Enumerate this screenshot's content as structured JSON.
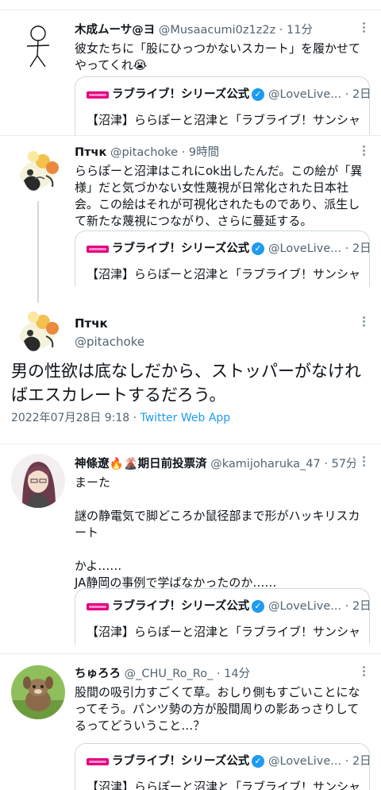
{
  "tweets": [
    {
      "name": "木成ムーサ@ヨ",
      "handle": "@Musaacumi0z1z2z",
      "time": "· 11分",
      "text": "彼女たちに「股にひっつかないスカート」を履かせてやってくれ😭",
      "avatar": "stick-figure",
      "quote": {
        "name": "ラブライブ！シリーズ公式",
        "handle": "@LoveLive... · 2日",
        "text": "【沼津】ららぽーと沼津と「ラブライブ！サンシャ"
      }
    },
    {
      "name": "Птчк",
      "handle": "@pitachoke",
      "time": "· 9時間",
      "text": "ららぽーと沼津はこれにok出したんだ。この絵が「異様」だと気づかない女性蔑視が日常化された日本社会。この絵はそれが可視化されたものであり、派生して新たな蔑視につながり、さらに蔓延する。",
      "avatar": "flower-art",
      "quote": {
        "name": "ラブライブ！シリーズ公式",
        "handle": "@LoveLive... · 2日",
        "text": "【沼津】ららぽーと沼津と「ラブライブ！サンシャ"
      }
    }
  ],
  "focus": {
    "name": "Птчк",
    "handle": "@pitachoke",
    "text": "男の性欲は底なしだから、ストッパーがなければエスカレートするだろう。",
    "date": "2022年07月28日 9:18 · ",
    "app": "Twitter Web App"
  },
  "replies": [
    {
      "name": "神條遼🔥🌋期日前投票済",
      "handle": "@kamijoharuka_47",
      "time": "· 57分",
      "lines": [
        "まーた",
        "",
        "謎の静電気で脚どころか鼠径部まで形がハッキリスカート",
        "",
        "かよ……",
        "JA静岡の事例で学ばなかったのか……"
      ],
      "avatar": "anime-girl",
      "quote": {
        "name": "ラブライブ！シリーズ公式",
        "handle": "@LoveLive... · 2日",
        "text": "【沼津】ららぽーと沼津と「ラブライブ！サンシャ"
      }
    },
    {
      "name": "ちゅろろ",
      "handle": "@_CHU_Ro_Ro_",
      "time": "· 14分",
      "text": "股間の吸引力すごくて草。おしり側もすごいことになってそう。パンツ勢の方が股間周りの影あっさりしてるってどういうこと…？",
      "avatar": "creature",
      "quote": {
        "name": "ラブライブ！シリーズ公式",
        "handle": "@LoveLive... · 2日",
        "text": "【沼津】ららぽーと沼津と「ラブライブ！サンシャ"
      }
    }
  ]
}
